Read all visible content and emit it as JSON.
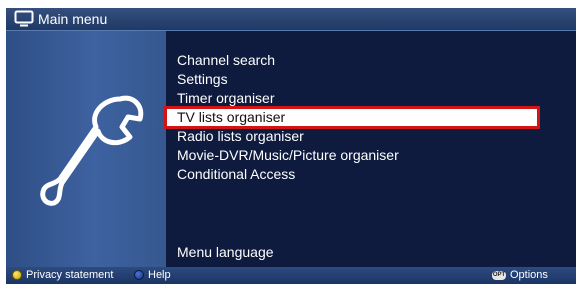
{
  "header": {
    "title": "Main menu",
    "icon": "tv-icon"
  },
  "menu": {
    "items": [
      {
        "label": "Channel search"
      },
      {
        "label": "Settings"
      },
      {
        "label": "Timer organiser"
      },
      {
        "label": "TV lists organiser",
        "selected": true
      },
      {
        "label": "Radio lists organiser"
      },
      {
        "label": "Movie-DVR/Music/Picture organiser"
      },
      {
        "label": "Conditional Access"
      }
    ],
    "language_item": "Menu language"
  },
  "footer": {
    "yellow_label": "Privacy statement",
    "blue_label": "Help",
    "opt_key": "OPT",
    "options_label": "Options"
  },
  "colors": {
    "background": "#0e1a3e",
    "panel": "#3e62a0",
    "selection_border": "#d21414"
  }
}
